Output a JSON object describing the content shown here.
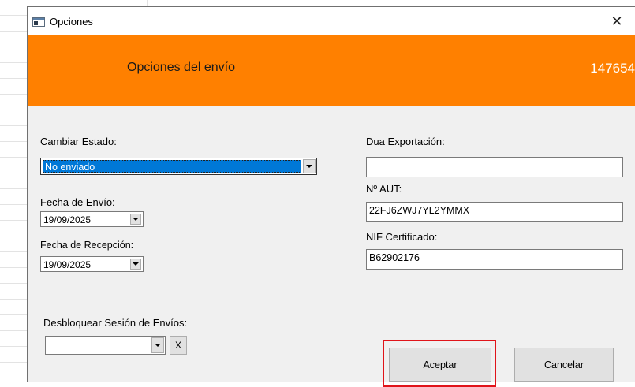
{
  "window": {
    "title": "Opciones",
    "close_glyph": "✕"
  },
  "header": {
    "title": "Opciones del envío",
    "number": "147654"
  },
  "estado": {
    "label": "Cambiar Estado:",
    "selected": "No enviado"
  },
  "fecha_envio": {
    "label": "Fecha de Envío:",
    "value": "19/09/2025"
  },
  "fecha_recepcion": {
    "label": "Fecha de Recepción:",
    "value": "19/09/2025"
  },
  "dua": {
    "label": "Dua Exportación:",
    "value": ""
  },
  "aut": {
    "label": "Nº AUT:",
    "value": "22FJ6ZWJ7YL2YMMX"
  },
  "nif": {
    "label": "NIF Certificado:",
    "value": "B62902176"
  },
  "desbloquear": {
    "label": "Desbloquear Sesión de Envíos:",
    "selected": "",
    "clear_label": "X"
  },
  "buttons": {
    "accept": "Aceptar",
    "cancel": "Cancelar"
  },
  "colors": {
    "header_bg": "#ff8000",
    "selection": "#0078d7",
    "highlight": "#e0141a"
  }
}
